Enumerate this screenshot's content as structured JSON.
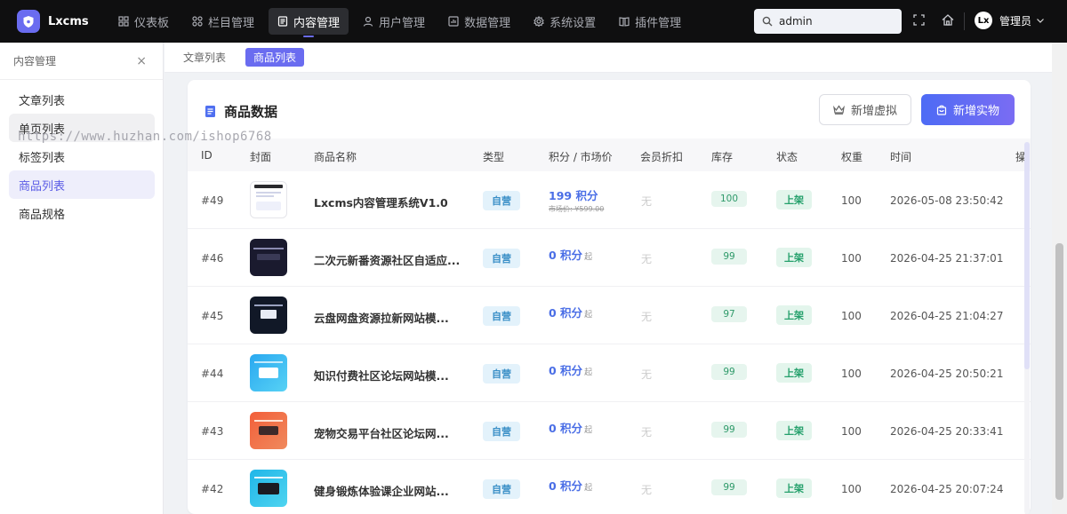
{
  "app": {
    "name": "Lxcms"
  },
  "nav": [
    {
      "label": "仪表板",
      "icon": "dashboard-icon"
    },
    {
      "label": "栏目管理",
      "icon": "grid-icon"
    },
    {
      "label": "内容管理",
      "icon": "document-icon",
      "active": true
    },
    {
      "label": "用户管理",
      "icon": "user-icon"
    },
    {
      "label": "数据管理",
      "icon": "chart-icon"
    },
    {
      "label": "系统设置",
      "icon": "gear-icon"
    },
    {
      "label": "插件管理",
      "icon": "book-icon"
    }
  ],
  "search": {
    "value": "admin"
  },
  "user": {
    "avatar_text": "Lx",
    "name": "管理员"
  },
  "sidebar": {
    "title": "内容管理",
    "close": "×",
    "items": [
      {
        "label": "文章列表"
      },
      {
        "label": "单页列表"
      },
      {
        "label": "标签列表"
      },
      {
        "label": "商品列表",
        "active": true
      },
      {
        "label": "商品规格"
      }
    ]
  },
  "tabs": [
    {
      "label": "文章列表"
    },
    {
      "label": "商品列表",
      "active": true
    }
  ],
  "card": {
    "title": "商品数据",
    "btn_virtual": "新增虚拟",
    "btn_physical": "新增实物"
  },
  "table": {
    "headers": [
      "ID",
      "封面",
      "商品名称",
      "类型",
      "积分 / 市场价",
      "会员折扣",
      "库存",
      "状态",
      "权重",
      "时间",
      "操"
    ],
    "rows": [
      {
        "id": "#49",
        "name": "Lxcms内容管理系统V1.0",
        "type": "自营",
        "points": "199 积分",
        "points_unit": "",
        "market": "市场价: ¥599.00",
        "member": "无",
        "stock": "100",
        "status": "上架",
        "weight": "100",
        "time": "2026-05-08 23:50:42"
      },
      {
        "id": "#46",
        "name": "二次元新番资源社区自适应...",
        "type": "自营",
        "points": "0 积分",
        "points_unit": "起",
        "market": "",
        "member": "无",
        "stock": "99",
        "status": "上架",
        "weight": "100",
        "time": "2026-04-25 21:37:01"
      },
      {
        "id": "#45",
        "name": "云盘网盘资源拉新网站模...",
        "type": "自营",
        "points": "0 积分",
        "points_unit": "起",
        "market": "",
        "member": "无",
        "stock": "97",
        "status": "上架",
        "weight": "100",
        "time": "2026-04-25 21:04:27"
      },
      {
        "id": "#44",
        "name": "知识付费社区论坛网站模...",
        "type": "自营",
        "points": "0 积分",
        "points_unit": "起",
        "market": "",
        "member": "无",
        "stock": "99",
        "status": "上架",
        "weight": "100",
        "time": "2026-04-25 20:50:21"
      },
      {
        "id": "#43",
        "name": "宠物交易平台社区论坛网...",
        "type": "自营",
        "points": "0 积分",
        "points_unit": "起",
        "market": "",
        "member": "无",
        "stock": "99",
        "status": "上架",
        "weight": "100",
        "time": "2026-04-25 20:33:41"
      },
      {
        "id": "#42",
        "name": "健身锻炼体验课企业网站...",
        "type": "自营",
        "points": "0 积分",
        "points_unit": "起",
        "market": "",
        "member": "无",
        "stock": "99",
        "status": "上架",
        "weight": "100",
        "time": "2026-04-25 20:07:24"
      }
    ]
  },
  "watermark": "https://www.huzhan.com/ishop6768",
  "colors": {
    "accent": "#6a6cf0",
    "topbar": "#0f0f10",
    "points": "#4a6ee6",
    "status": "#24a06b"
  }
}
